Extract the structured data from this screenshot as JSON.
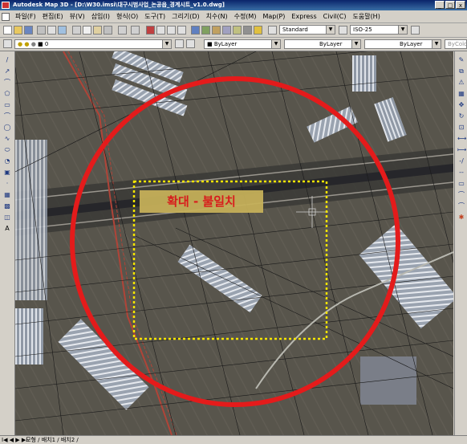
{
  "window": {
    "title": "Autodesk Map 3D - [D:\\W30.imsi\\대구시범사업_논공읍_경계시트_v1.0.dwg]",
    "controls": [
      "_",
      "□",
      "x"
    ]
  },
  "menu": {
    "items": [
      "파일(F)",
      "편집(E)",
      "뷰(V)",
      "삽입(I)",
      "형식(O)",
      "도구(T)",
      "그리기(D)",
      "치수(N)",
      "수정(M)",
      "Map(P)",
      "Express",
      "Civil(C)",
      "도움말(H)"
    ]
  },
  "toolbar": {
    "text_style": "Standard",
    "dim_style": "ISO-25",
    "layer": "0",
    "color": "ByLayer",
    "linetype": "ByLayer",
    "lineweight": "ByLayer",
    "plotstyle": "ByColor"
  },
  "left_tools": [
    "/",
    "↗",
    "⌒",
    "⬠",
    "▭",
    "⌒",
    "◯",
    "∿",
    "⬭",
    "◔",
    "▣",
    "·",
    "▦",
    "▩",
    "◫",
    "A"
  ],
  "right_tools": [
    "✎",
    "⧉",
    "⚠",
    "▦",
    "✥",
    "↻",
    "⊡",
    "⟷",
    "⟼",
    "-/",
    "--",
    "▭",
    "⌒",
    "⌒",
    "✱"
  ],
  "annotation": {
    "label": "확대 - 불일치"
  },
  "status": {
    "nav": "I◀ ◀ ▶ ▶I",
    "tabs": "모형 / 배치1 / 배치2 /"
  },
  "colors": {
    "circle": "#e41b1b",
    "dashed_rect": "#f5e500",
    "label_bg": "#c8b25a",
    "label_text": "#e41b1b"
  }
}
